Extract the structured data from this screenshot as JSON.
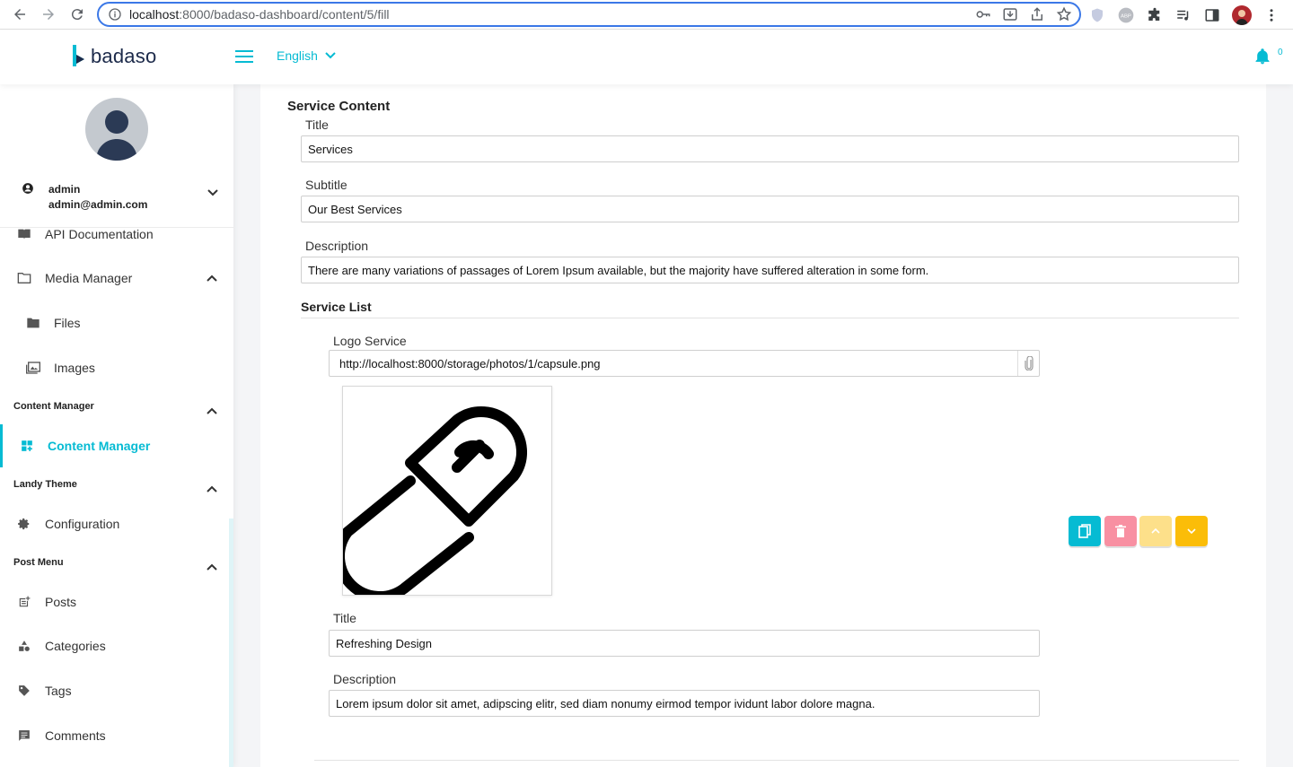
{
  "browser": {
    "url_host": "localhost",
    "url_rest": ":8000/badaso-dashboard/content/5/fill"
  },
  "header": {
    "logo_text": "badaso",
    "language": "English",
    "notification_count": "0"
  },
  "sidebar": {
    "user": {
      "name": "admin",
      "email": "admin@admin.com"
    },
    "items": [
      {
        "label": "API Documentation"
      },
      {
        "label": "Media Manager"
      },
      {
        "label": "Files"
      },
      {
        "label": "Images"
      }
    ],
    "groups": [
      {
        "label": "Content Manager"
      },
      {
        "label": "Landy Theme"
      },
      {
        "label": "Post Menu"
      }
    ],
    "content_manager_item": "Content Manager",
    "configuration_item": "Configuration",
    "post_items": [
      {
        "label": "Posts"
      },
      {
        "label": "Categories"
      },
      {
        "label": "Tags"
      },
      {
        "label": "Comments"
      }
    ]
  },
  "form": {
    "section_title": "Service Content",
    "title_label": "Title",
    "title_value": "Services",
    "subtitle_label": "Subtitle",
    "subtitle_value": "Our Best Services",
    "description_label": "Description",
    "description_value": "There are many variations of passages of Lorem Ipsum available, but the majority have suffered alteration in some form.",
    "service_list_title": "Service List",
    "service_item": {
      "logo_label": "Logo Service",
      "logo_value": "http://localhost:8000/storage/photos/1/capsule.png",
      "title_label": "Title",
      "title_value": "Refreshing Design",
      "description_label": "Description",
      "description_value": "Lorem ipsum dolor sit amet, adipscing elitr, sed diam nonumy eirmod tempor ividunt labor dolore magna."
    }
  },
  "colors": {
    "accent": "#06bbd3",
    "copy_button": "#06bbd3",
    "delete_button": "#f890a2",
    "up_button": "#fde08a",
    "down_button": "#fbbd08"
  }
}
